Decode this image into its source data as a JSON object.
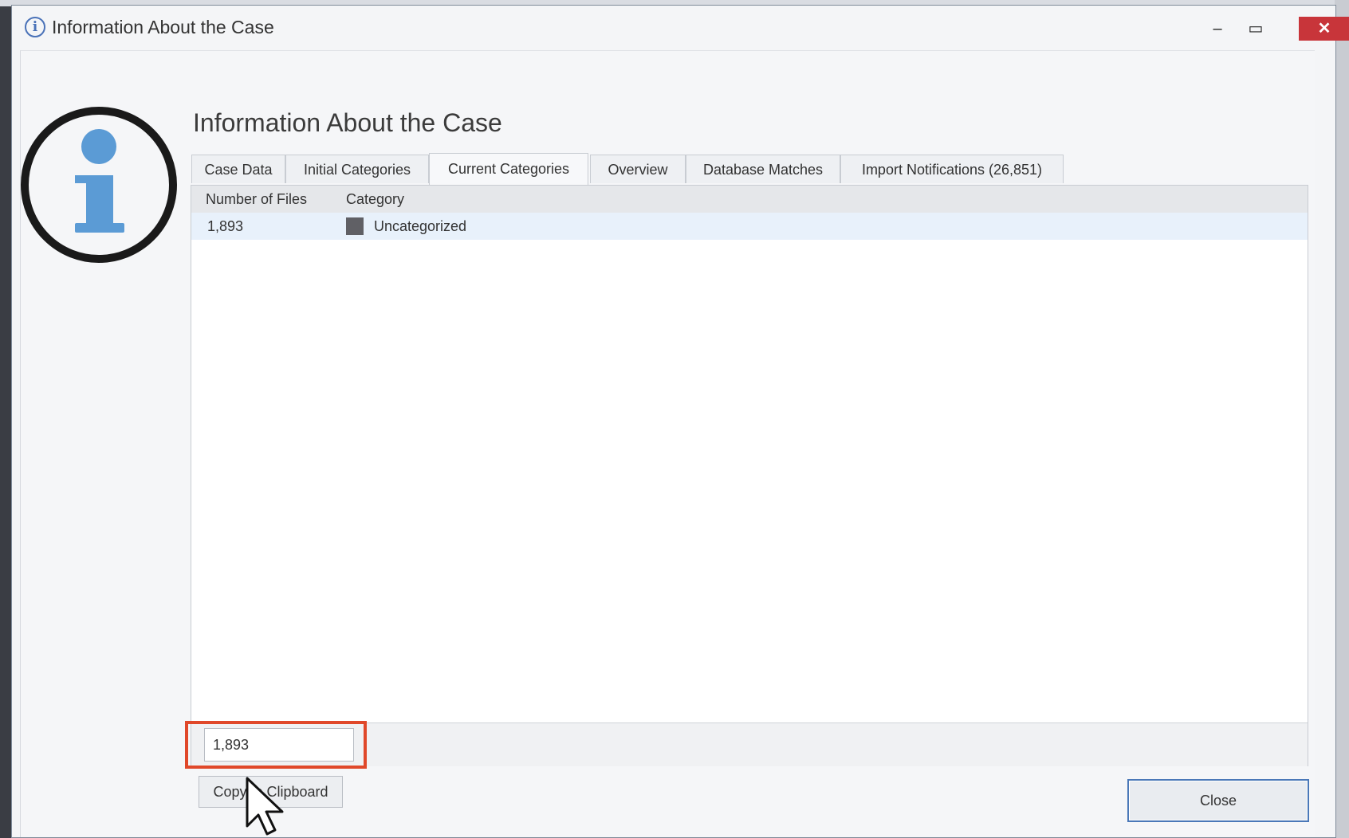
{
  "window": {
    "title": "Information About the Case",
    "minimize_glyph": "‒",
    "maximize_glyph": "▭",
    "close_glyph": "✕"
  },
  "main": {
    "heading": "Information About the Case",
    "tabs": [
      {
        "label": "Case Data"
      },
      {
        "label": "Initial Categories"
      },
      {
        "label": "Current Categories",
        "active": true
      },
      {
        "label": "Overview"
      },
      {
        "label": "Database Matches"
      },
      {
        "label": "Import Notifications (26,851)"
      }
    ],
    "grid": {
      "columns": [
        "Number of Files",
        "Category"
      ],
      "rows": [
        {
          "number_of_files": "1,893",
          "category": "Uncategorized",
          "color": "#606065"
        }
      ]
    },
    "total_field": {
      "value": "1,893"
    },
    "copy_button_label": "Copy to Clipboard",
    "close_button_label": "Close"
  },
  "colors": {
    "accent": "#5b9bd5",
    "highlight": "#e0482a",
    "close_button": "#c8353a"
  },
  "icons": {
    "title": "info-icon",
    "large": "info-icon",
    "cursor": "mouse-pointer-icon"
  }
}
